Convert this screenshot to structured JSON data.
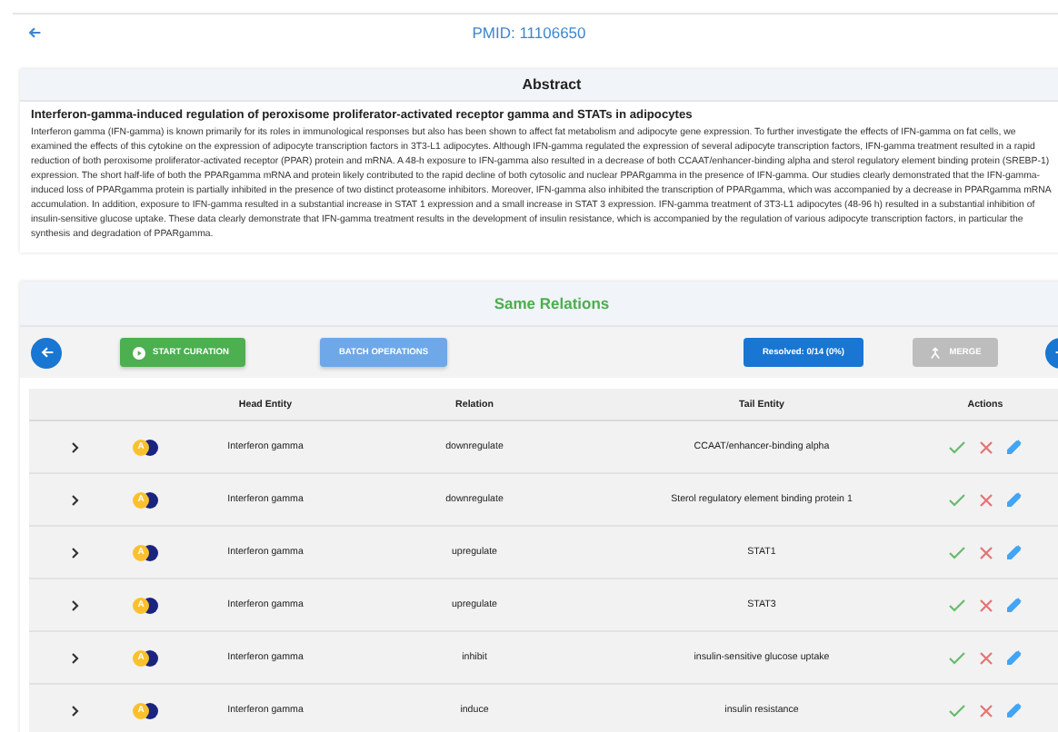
{
  "header": {
    "title": "PMID: 11106650"
  },
  "abstract": {
    "heading": "Abstract",
    "title": "Interferon-gamma-induced regulation of peroxisome proliferator-activated receptor gamma and STATs in adipocytes",
    "text": "Interferon gamma (IFN-gamma) is known primarily for its roles in immunological responses but also has been shown to affect fat metabolism and adipocyte gene expression. To further investigate the effects of IFN-gamma on fat cells, we examined the effects of this cytokine on the expression of adipocyte transcription factors in 3T3-L1 adipocytes. Although IFN-gamma regulated the expression of several adipocyte transcription factors, IFN-gamma treatment resulted in a rapid reduction of both peroxisome proliferator-activated receptor (PPAR) protein and mRNA. A 48-h exposure to IFN-gamma also resulted in a decrease of both CCAAT/enhancer-binding alpha and sterol regulatory element binding protein (SREBP-1) expression. The short half-life of both the PPARgamma mRNA and protein likely contributed to the rapid decline of both cytosolic and nuclear PPARgamma in the presence of IFN-gamma. Our studies clearly demonstrated that the IFN-gamma-induced loss of PPARgamma protein is partially inhibited in the presence of two distinct proteasome inhibitors. Moreover, IFN-gamma also inhibited the transcription of PPARgamma, which was accompanied by a decrease in PPARgamma mRNA accumulation. In addition, exposure to IFN-gamma resulted in a substantial increase in STAT 1 expression and a small increase in STAT 3 expression. IFN-gamma treatment of 3T3-L1 adipocytes (48-96 h) resulted in a substantial inhibition of insulin-sensitive glucose uptake. These data clearly demonstrate that IFN-gamma treatment results in the development of insulin resistance, which is accompanied by the regulation of various adipocyte transcription factors, in particular the synthesis and degradation of PPARgamma."
  },
  "relations": {
    "heading": "Same Relations",
    "toolbar": {
      "start": "START CURATION",
      "batch": "BATCH OPERATIONS",
      "resolved": "Resolved: 0/14 (0%)",
      "merge": {
        "label": "MERGE",
        "disabled": true
      }
    },
    "columns": [
      "Head Entity",
      "Relation",
      "Tail Entity",
      "Actions"
    ],
    "rows": [
      {
        "badge": "A",
        "head": "Interferon gamma",
        "relation": "downregulate",
        "tail": "CCAAT/enhancer-binding alpha"
      },
      {
        "badge": "A",
        "head": "Interferon gamma",
        "relation": "downregulate",
        "tail": "Sterol regulatory element binding protein 1"
      },
      {
        "badge": "A",
        "head": "Interferon gamma",
        "relation": "upregulate",
        "tail": "STAT1"
      },
      {
        "badge": "A",
        "head": "Interferon gamma",
        "relation": "upregulate",
        "tail": "STAT3"
      },
      {
        "badge": "A",
        "head": "Interferon gamma",
        "relation": "inhibit",
        "tail": "insulin-sensitive glucose uptake"
      },
      {
        "badge": "A",
        "head": "Interferon gamma",
        "relation": "induce",
        "tail": "insulin resistance"
      }
    ]
  }
}
